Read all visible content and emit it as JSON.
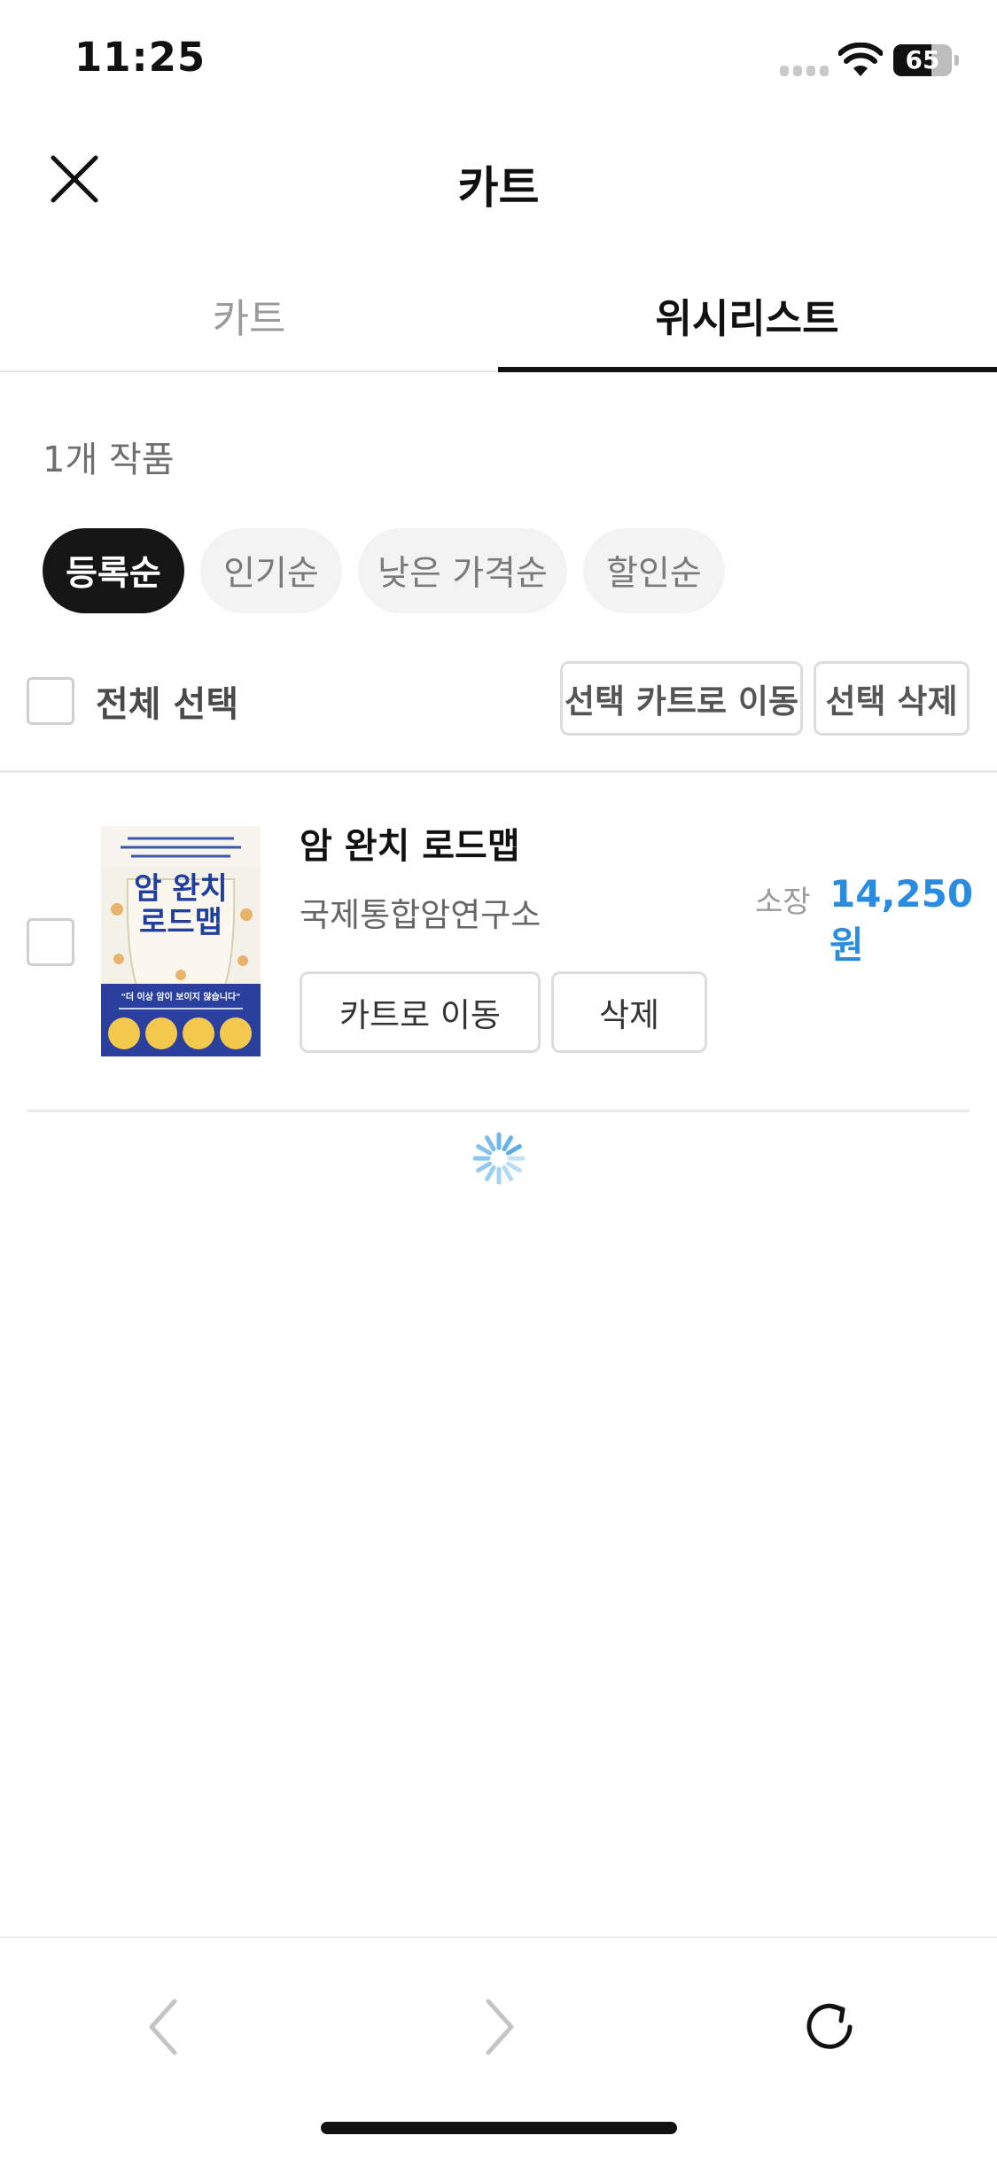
{
  "status_bar": {
    "time": "11:25",
    "battery_percent": 65,
    "battery_label": "65"
  },
  "header": {
    "title": "카트",
    "close_icon": "close-icon"
  },
  "tabs": [
    {
      "label": "카트",
      "active": false
    },
    {
      "label": "위시리스트",
      "active": true
    }
  ],
  "wishlist": {
    "count_label": "1개 작품",
    "sort_options": [
      {
        "label": "등록순",
        "active": true
      },
      {
        "label": "인기순",
        "active": false
      },
      {
        "label": "낮은 가격순",
        "active": false
      },
      {
        "label": "할인순",
        "active": false
      }
    ],
    "select_all_label": "전체 선택",
    "move_selected_label": "선택 카트로 이동",
    "delete_selected_label": "선택 삭제",
    "items": [
      {
        "title": "암 완치 로드맵",
        "author": "국제통합암연구소",
        "price_prefix": "소장",
        "price": "14,250원",
        "move_label": "카트로 이동",
        "delete_label": "삭제",
        "checked": false
      }
    ]
  },
  "book_cover": {
    "title_lines": [
      "암 완치",
      "로드맵"
    ],
    "banner": "\"더 이상 암이 보이지 않습니다\""
  },
  "colors": {
    "accent_price": "#2a8ce0",
    "chip_active": "#151515",
    "spinner": "#5aaee8"
  },
  "bottom_nav": {
    "back_icon": "chevron-left-icon",
    "forward_icon": "chevron-right-icon",
    "reload_icon": "reload-icon"
  }
}
